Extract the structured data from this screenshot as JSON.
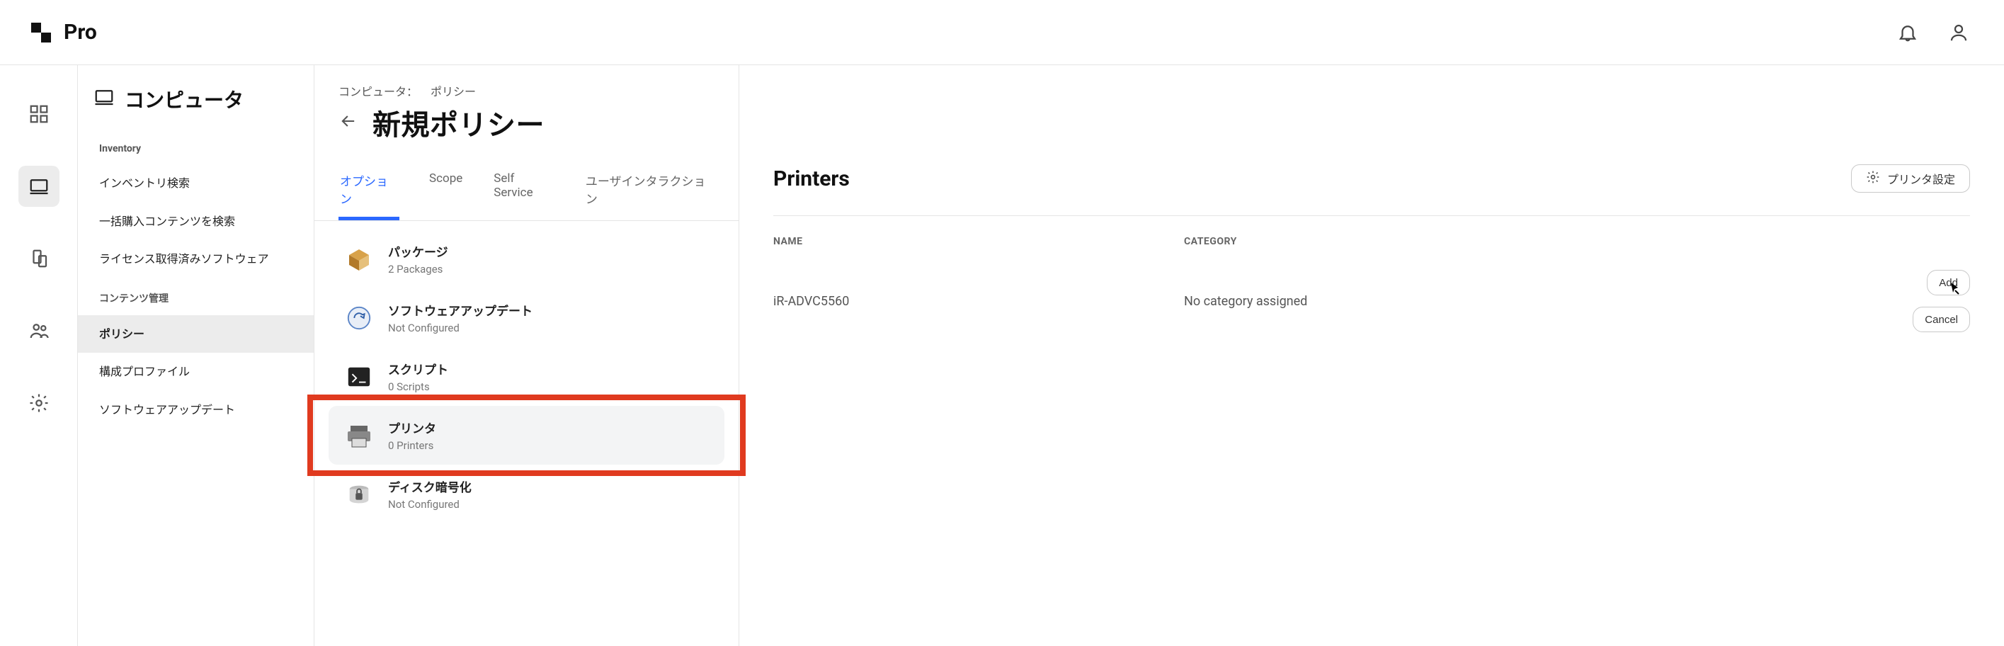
{
  "brand": {
    "name": "Pro"
  },
  "topbar": {
    "bell_icon": "bell-icon",
    "user_icon": "user-icon"
  },
  "rail": {
    "items": [
      {
        "name": "dashboard-icon"
      },
      {
        "name": "laptop-icon",
        "active": true
      },
      {
        "name": "devices-icon"
      },
      {
        "name": "users-icon"
      },
      {
        "name": "settings-icon"
      }
    ]
  },
  "sidebar": {
    "title_icon": "laptop-icon",
    "title": "コンピュータ",
    "sections": [
      {
        "label": "Inventory",
        "items": [
          "インベントリ検索",
          "一括購入コンテンツを検索",
          "ライセンス取得済みソフトウェア"
        ]
      },
      {
        "label": "コンテンツ管理",
        "items": [
          "ポリシー",
          "構成プロファイル",
          "ソフトウェアアップデート"
        ],
        "active_index": 0
      }
    ]
  },
  "breadcrumb": {
    "a": "コンピュータ：",
    "b": "ポリシー"
  },
  "page_title": "新規ポリシー",
  "tabs": [
    {
      "label": "オプション",
      "active": true
    },
    {
      "label": "Scope"
    },
    {
      "label": "Self Service"
    },
    {
      "label": "ユーザインタラクション"
    }
  ],
  "options": [
    {
      "title": "パッケージ",
      "sub": "2 Packages",
      "icon": "package-icon"
    },
    {
      "title": "ソフトウェアアップデート",
      "sub": "Not Configured",
      "icon": "update-icon"
    },
    {
      "title": "スクリプト",
      "sub": "0 Scripts",
      "icon": "terminal-icon"
    },
    {
      "title": "プリンタ",
      "sub": "0 Printers",
      "icon": "printer-icon",
      "selected": true,
      "highlight": true
    },
    {
      "title": "ディスク暗号化",
      "sub": "Not Configured",
      "icon": "disk-lock-icon"
    }
  ],
  "main": {
    "heading": "Printers",
    "settings_button": "プリンタ設定",
    "table": {
      "col_name": "NAME",
      "col_category": "CATEGORY",
      "rows": [
        {
          "name": "iR-ADVC5560",
          "category": "No category assigned"
        }
      ],
      "add_label": "Add",
      "cancel_label": "Cancel"
    }
  }
}
